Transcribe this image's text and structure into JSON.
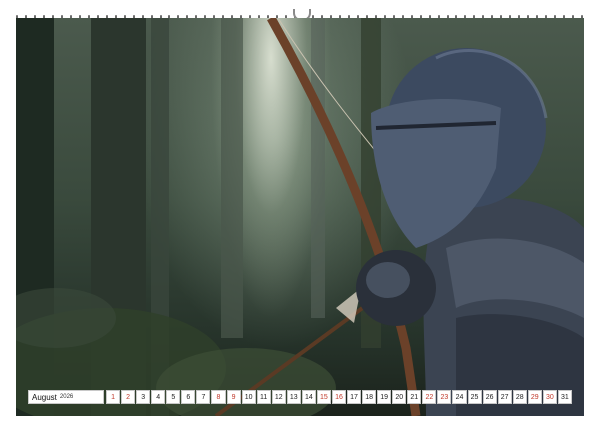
{
  "calendar": {
    "month": "August",
    "year": "2026",
    "days": [
      {
        "label": "1",
        "weekend": true
      },
      {
        "label": "2",
        "weekend": true
      },
      {
        "label": "3",
        "weekend": false
      },
      {
        "label": "4",
        "weekend": false
      },
      {
        "label": "5",
        "weekend": false
      },
      {
        "label": "6",
        "weekend": false
      },
      {
        "label": "7",
        "weekend": false
      },
      {
        "label": "8",
        "weekend": true
      },
      {
        "label": "9",
        "weekend": true
      },
      {
        "label": "10",
        "weekend": false
      },
      {
        "label": "11",
        "weekend": false
      },
      {
        "label": "12",
        "weekend": false
      },
      {
        "label": "13",
        "weekend": false
      },
      {
        "label": "14",
        "weekend": false
      },
      {
        "label": "15",
        "weekend": true
      },
      {
        "label": "16",
        "weekend": true
      },
      {
        "label": "17",
        "weekend": false
      },
      {
        "label": "18",
        "weekend": false
      },
      {
        "label": "19",
        "weekend": false
      },
      {
        "label": "20",
        "weekend": false
      },
      {
        "label": "21",
        "weekend": false
      },
      {
        "label": "22",
        "weekend": true
      },
      {
        "label": "23",
        "weekend": true
      },
      {
        "label": "24",
        "weekend": false
      },
      {
        "label": "25",
        "weekend": false
      },
      {
        "label": "26",
        "weekend": false
      },
      {
        "label": "27",
        "weekend": false
      },
      {
        "label": "28",
        "weekend": false
      },
      {
        "label": "29",
        "weekend": true
      },
      {
        "label": "30",
        "weekend": true
      },
      {
        "label": "31",
        "weekend": false
      }
    ],
    "weekend_color": "#c0392b"
  }
}
